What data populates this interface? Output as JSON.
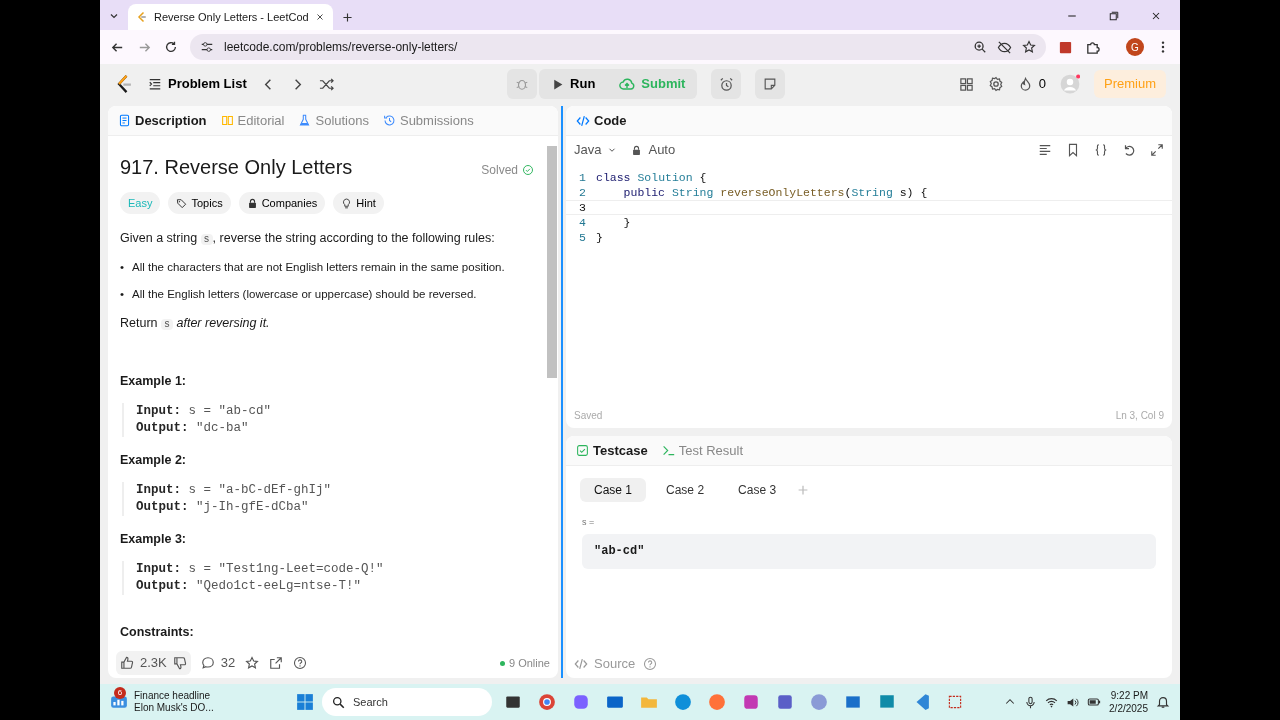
{
  "browser": {
    "tab_title": "Reverse Only Letters - LeetCod",
    "url": "leetcode.com/problems/reverse-only-letters/",
    "profile_initial": "G"
  },
  "nav": {
    "problem_list": "Problem List",
    "run": "Run",
    "submit": "Submit",
    "streak": "0",
    "premium": "Premium"
  },
  "left_tabs": [
    {
      "label": "Description",
      "selected": true
    },
    {
      "label": "Editorial",
      "selected": false
    },
    {
      "label": "Solutions",
      "selected": false
    },
    {
      "label": "Submissions",
      "selected": false
    }
  ],
  "problem": {
    "title": "917. Reverse Only Letters",
    "status": "Solved",
    "difficulty": "Easy",
    "tags": [
      "Topics",
      "Companies",
      "Hint"
    ],
    "intro": {
      "before": "Given a string",
      "code": "s",
      "after": ", reverse the string according to the following rules:"
    },
    "rules": [
      {
        "marker": "•",
        "text": "All the characters that are not English letters remain in the same position."
      },
      {
        "marker": "•",
        "text": "All the English letters (lowercase or uppercase) should be reversed."
      }
    ],
    "return": {
      "before": "Return",
      "code": "s",
      "after": "*after reversing it.*"
    },
    "examples": [
      {
        "title": "Example 1:",
        "input_label": "Input:",
        "input": "s = \"ab-cd\"",
        "output_label": "Output:",
        "output": "\"dc-ba\""
      },
      {
        "title": "Example 2:",
        "input_label": "Input:",
        "input": "s = \"a-bC-dEf-ghIj\"",
        "output_label": "Output:",
        "output": "\"j-Ih-gfE-dCba\""
      },
      {
        "title": "Example 3:",
        "input_label": "Input:",
        "input": "s = \"Test1ng-Leet=code-Q!\"",
        "output_label": "Output:",
        "output": "\"Qedo1ct-eeLg=ntse-T!\""
      }
    ],
    "constraints_heading": "Constraints:"
  },
  "footer": {
    "likes": "2.3K",
    "comments": "32",
    "online": "9 Online"
  },
  "code_panel": {
    "tab": "Code",
    "language": "Java",
    "mode": "Auto",
    "lines": [
      {
        "number": "1",
        "current": false,
        "tokens": [
          {
            "kind": "keyword",
            "text": "class "
          },
          {
            "kind": "type",
            "text": "Solution "
          },
          {
            "kind": "plain",
            "text": "{"
          }
        ]
      },
      {
        "number": "2",
        "current": false,
        "tokens": [
          {
            "kind": "keyword",
            "text": "    public "
          },
          {
            "kind": "type",
            "text": "String "
          },
          {
            "kind": "method",
            "text": "reverseOnlyLetters"
          },
          {
            "kind": "plain",
            "text": "("
          },
          {
            "kind": "type",
            "text": "String"
          },
          {
            "kind": "plain",
            "text": " s) {"
          }
        ]
      },
      {
        "number": "3",
        "current": true
      },
      {
        "number": "4",
        "current": false,
        "tokens": [
          {
            "kind": "plain",
            "text": "    }"
          }
        ]
      },
      {
        "number": "5",
        "current": false,
        "tokens": [
          {
            "kind": "plain",
            "text": "}"
          }
        ]
      }
    ],
    "status": "Saved",
    "position": "Ln 3, Col 9"
  },
  "test_tabs": [
    {
      "label": "Testcase",
      "selected": true
    },
    {
      "label": "Test Result",
      "selected": false
    }
  ],
  "cases": [
    {
      "label": "Case 1",
      "selected": true
    },
    {
      "label": "Case 2",
      "selected": false
    },
    {
      "label": "Case 3",
      "selected": false
    }
  ],
  "param": {
    "label": "s =",
    "value": "\"ab-cd\""
  },
  "source": "Source",
  "taskbar": {
    "news_badge": "6",
    "news_title": "Finance headline",
    "news_subtitle": "Elon Musk's DO...",
    "search": "Search",
    "time": "9:22 PM",
    "date": "2/2/2025"
  }
}
